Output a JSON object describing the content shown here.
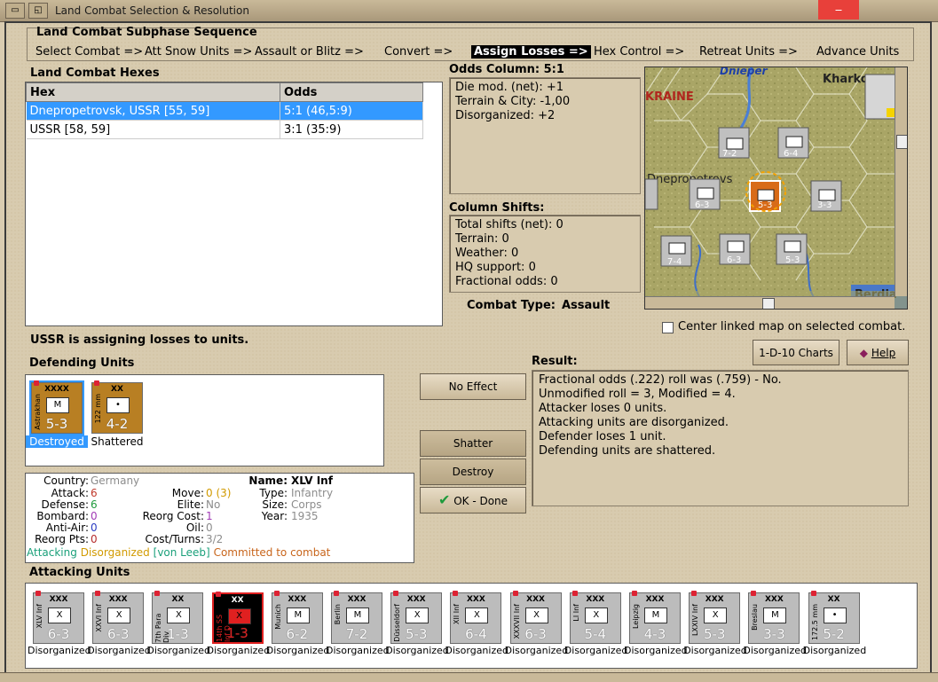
{
  "window": {
    "title": "Land Combat Selection & Resolution"
  },
  "sequence": {
    "title": "Land Combat Subphase Sequence",
    "steps": [
      "Select Combat =>",
      "Att Snow Units =>",
      "Assault or Blitz =>",
      "Convert =>",
      "Assign Losses =>",
      "Hex Control =>",
      "Retreat Units =>",
      "Advance Units"
    ],
    "active_index": 4
  },
  "hexes": {
    "title": "Land Combat Hexes",
    "columns": [
      "Hex",
      "Odds"
    ],
    "rows": [
      {
        "hex": "Dnepropetrovsk, USSR [55, 59]",
        "odds": "5:1 (46,5:9)"
      },
      {
        "hex": "USSR [58, 59]",
        "odds": "3:1 (35:9)"
      }
    ]
  },
  "odds": {
    "title": "Odds Column: 5:1",
    "lines": [
      "Die mod. (net): +1",
      "Terrain & City: -1,00",
      "Disorganized: +2"
    ]
  },
  "shifts": {
    "title": "Column Shifts:",
    "lines": [
      "Total shifts (net): 0",
      "Terrain: 0",
      "Weather: 0",
      "HQ support: 0",
      "Fractional odds: 0"
    ]
  },
  "combat_type": {
    "label": "Combat Type:",
    "value": "Assault"
  },
  "map": {
    "labels": [
      "Dnieper",
      "Kharkov",
      "KRAINE",
      "Dnepropetrovs",
      "Berdia"
    ],
    "center_linked": "Center linked map on selected combat."
  },
  "status_message": "USSR is assigning losses to units.",
  "defending": {
    "title": "Defending Units",
    "units": [
      {
        "size": "XXXX",
        "side": "Astrakhan",
        "str": "5-3",
        "label": "Destroyed",
        "color": "#b87f23",
        "selected": true
      },
      {
        "size": "XX",
        "side": "122 mm",
        "str": "4-2",
        "label": "Shattered",
        "color": "#b87f23",
        "selected": false
      }
    ]
  },
  "unit_info": {
    "country_label": "Country:",
    "country": "Germany",
    "attack_label": "Attack:",
    "attack": "6",
    "defense_label": "Defense:",
    "defense": "6",
    "bombard_label": "Bombard:",
    "bombard": "0",
    "antiair_label": "Anti-Air:",
    "antiair": "0",
    "reorgpts_label": "Reorg Pts:",
    "reorgpts": "0",
    "name_label": "Name:",
    "name": "XLV Inf",
    "move_label": "Move:",
    "move": "0 (3)",
    "elite_label": "Elite:",
    "elite": "No",
    "reorgcost_label": "Reorg Cost:",
    "reorgcost": "1",
    "oil_label": "Oil:",
    "oil": "0",
    "costturns_label": "Cost/Turns:",
    "costturns": "3/2",
    "type_label": "Type:",
    "type": "Infantry",
    "size_label": "Size:",
    "size": "Corps",
    "year_label": "Year:",
    "year": "1935",
    "status_attacking": "Attacking",
    "status_disorganized": "Disorganized",
    "status_leader": "[von Leeb]",
    "status_committed": "Committed to combat"
  },
  "buttons": {
    "no_effect": "No Effect",
    "shatter": "Shatter",
    "destroy": "Destroy",
    "ok_done": "OK - Done",
    "charts": "1-D-10 Charts",
    "help": "Help"
  },
  "result": {
    "title": "Result:",
    "lines": [
      "Fractional odds (.222) roll was (.759)  -  No.",
      "Unmodified roll = 3, Modified = 4.",
      "Attacker loses 0 units.",
      "Attacking units are disorganized.",
      "Defender loses 1 unit.",
      "Defending units are shattered."
    ]
  },
  "attacking": {
    "title": "Attacking Units",
    "units": [
      {
        "size": "XXX",
        "side": "XLV Inf",
        "str": "6-3",
        "label": "Disorganized",
        "sym": "X",
        "dark": false
      },
      {
        "size": "XXX",
        "side": "XXVI Inf",
        "str": "6-3",
        "label": "Disorganized",
        "sym": "X",
        "dark": false
      },
      {
        "size": "XX",
        "side": "7th Para Div",
        "str": "1-3",
        "label": "Disorganized",
        "sym": "X",
        "dark": false
      },
      {
        "size": "XX",
        "side": "14th SS Inf D.",
        "str": "1-3",
        "label": "Disorganized",
        "sym": "X",
        "dark": true
      },
      {
        "size": "XXX",
        "side": "Munich",
        "str": "6-2",
        "label": "Disorganized",
        "sym": "M",
        "dark": false
      },
      {
        "size": "XXX",
        "side": "Berlin",
        "str": "7-2",
        "label": "Disorganized",
        "sym": "M",
        "dark": false
      },
      {
        "size": "XXX",
        "side": "Düsseldorf",
        "str": "5-3",
        "label": "Disorganized",
        "sym": "X",
        "dark": false
      },
      {
        "size": "XXX",
        "side": "XII Inf",
        "str": "6-4",
        "label": "Disorganized",
        "sym": "X",
        "dark": false
      },
      {
        "size": "XXX",
        "side": "XXXVII Inf",
        "str": "6-3",
        "label": "Disorganized",
        "sym": "X",
        "dark": false
      },
      {
        "size": "XXX",
        "side": "LI Inf",
        "str": "5-4",
        "label": "Disorganized",
        "sym": "X",
        "dark": false
      },
      {
        "size": "XXX",
        "side": "Leipzig",
        "str": "4-3",
        "label": "Disorganized",
        "sym": "M",
        "dark": false
      },
      {
        "size": "XXX",
        "side": "LXXIV Inf",
        "str": "5-3",
        "label": "Disorganized",
        "sym": "X",
        "dark": false
      },
      {
        "size": "XXX",
        "side": "Breslau",
        "str": "3-3",
        "label": "Disorganized",
        "sym": "M",
        "dark": false
      },
      {
        "size": "XX",
        "side": "172.5 mm",
        "str": "5-2",
        "label": "Disorganized",
        "sym": "•",
        "dark": false
      }
    ]
  },
  "colors": {
    "attack": "#c0392b",
    "defense": "#1e9a3c",
    "bombard": "#a13bb5",
    "antiair": "#2b3cc2",
    "reorgpts": "#b52b2b",
    "grey": "#8c8c8c",
    "attacking": "#1aa07a",
    "disorganized": "#d19a00",
    "committed": "#c8651b",
    "selection": "#3399ff"
  }
}
